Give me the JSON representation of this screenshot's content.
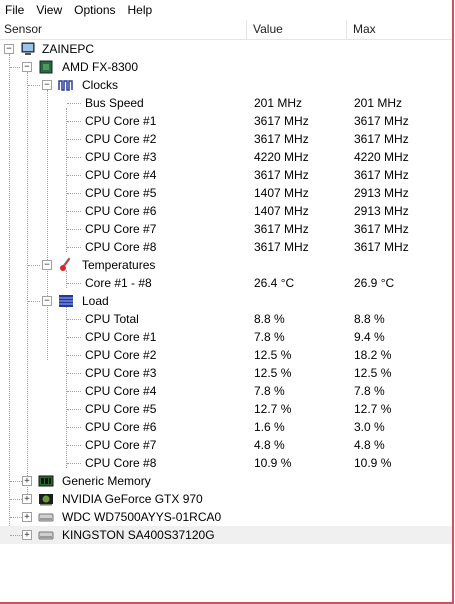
{
  "menu": [
    "File",
    "View",
    "Options",
    "Help"
  ],
  "columns": {
    "sensor": "Sensor",
    "value": "Value",
    "max": "Max"
  },
  "tree": {
    "computer": "ZAINEPC",
    "cpu": "AMD FX-8300",
    "clocks": {
      "label": "Clocks",
      "rows": [
        {
          "name": "Bus Speed",
          "value": "201 MHz",
          "max": "201 MHz"
        },
        {
          "name": "CPU Core #1",
          "value": "3617 MHz",
          "max": "3617 MHz"
        },
        {
          "name": "CPU Core #2",
          "value": "3617 MHz",
          "max": "3617 MHz"
        },
        {
          "name": "CPU Core #3",
          "value": "4220 MHz",
          "max": "4220 MHz"
        },
        {
          "name": "CPU Core #4",
          "value": "3617 MHz",
          "max": "3617 MHz"
        },
        {
          "name": "CPU Core #5",
          "value": "1407 MHz",
          "max": "2913 MHz"
        },
        {
          "name": "CPU Core #6",
          "value": "1407 MHz",
          "max": "2913 MHz"
        },
        {
          "name": "CPU Core #7",
          "value": "3617 MHz",
          "max": "3617 MHz"
        },
        {
          "name": "CPU Core #8",
          "value": "3617 MHz",
          "max": "3617 MHz"
        }
      ]
    },
    "temperatures": {
      "label": "Temperatures",
      "rows": [
        {
          "name": "Core #1 - #8",
          "value": "26.4 °C",
          "max": "26.9 °C"
        }
      ]
    },
    "load": {
      "label": "Load",
      "rows": [
        {
          "name": "CPU Total",
          "value": "8.8 %",
          "max": "8.8 %"
        },
        {
          "name": "CPU Core #1",
          "value": "7.8 %",
          "max": "9.4 %"
        },
        {
          "name": "CPU Core #2",
          "value": "12.5 %",
          "max": "18.2 %"
        },
        {
          "name": "CPU Core #3",
          "value": "12.5 %",
          "max": "12.5 %"
        },
        {
          "name": "CPU Core #4",
          "value": "7.8 %",
          "max": "7.8 %"
        },
        {
          "name": "CPU Core #5",
          "value": "12.7 %",
          "max": "12.7 %"
        },
        {
          "name": "CPU Core #6",
          "value": "1.6 %",
          "max": "3.0 %"
        },
        {
          "name": "CPU Core #7",
          "value": "4.8 %",
          "max": "4.8 %"
        },
        {
          "name": "CPU Core #8",
          "value": "10.9 %",
          "max": "10.9 %"
        }
      ]
    },
    "devices": [
      {
        "name": "Generic Memory",
        "icon": "memory-icon"
      },
      {
        "name": "NVIDIA GeForce GTX 970",
        "icon": "gpu-icon"
      },
      {
        "name": "WDC WD7500AYYS-01RCA0",
        "icon": "hard-drive-icon"
      },
      {
        "name": "KINGSTON SA400S37120G",
        "icon": "hard-drive-icon"
      }
    ]
  }
}
